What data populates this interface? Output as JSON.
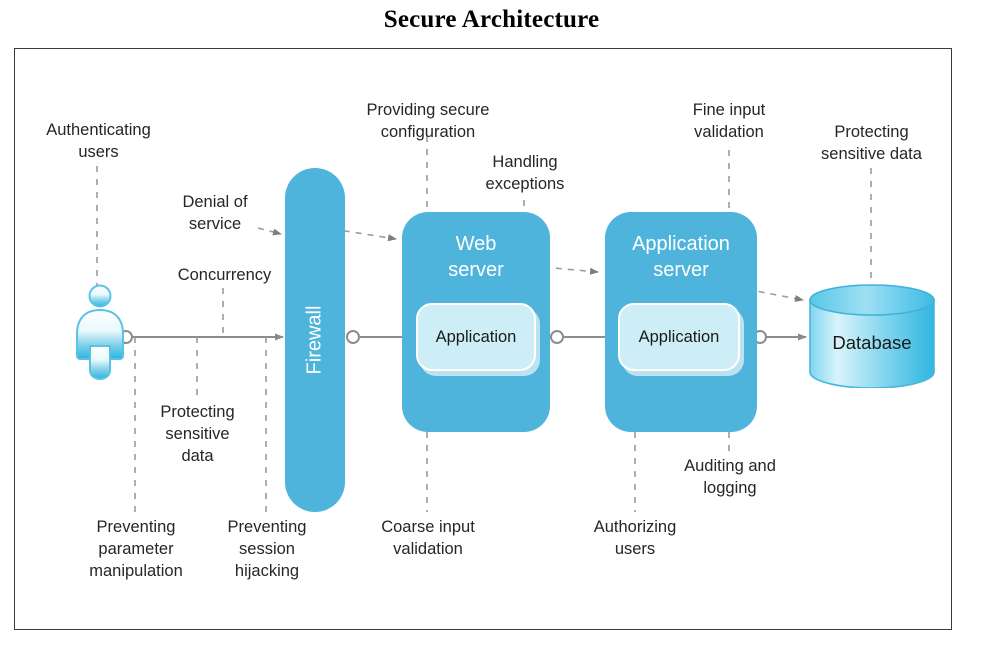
{
  "title": "Secure Architecture",
  "diagram": {
    "type": "architecture-flow",
    "accent_color": "#4fb4dc",
    "inner_color": "#cdeef6",
    "line_color": "#8c8c8c",
    "frame_color": "#3a3a3a",
    "text_color": "#262626"
  },
  "nodes": {
    "actor": {
      "name": "actor",
      "label": ""
    },
    "firewall": {
      "label": "Firewall"
    },
    "web_server": {
      "label": "Web\nserver",
      "inner_label": "Application"
    },
    "app_server": {
      "label": "Application\nserver",
      "inner_label": "Application"
    },
    "database": {
      "label": "Database"
    }
  },
  "annotations": {
    "authenticating_users": "Authenticating\nusers",
    "denial_of_service": "Denial of\nservice",
    "concurrency": "Concurrency",
    "protecting_sensitive_data_left": "Protecting\nsensitive\ndata",
    "preventing_parameter_manipulation": "Preventing\nparameter\nmanipulation",
    "preventing_session_hijacking": "Preventing\nsession\nhijacking",
    "providing_secure_configuration": "Providing secure\nconfiguration",
    "handling_exceptions": "Handling\nexceptions",
    "coarse_input_validation": "Coarse input\nvalidation",
    "fine_input_validation": "Fine input\nvalidation",
    "protecting_sensitive_data_right": "Protecting\nsensitive data",
    "authorizing_users": "Authorizing\nusers",
    "auditing_and_logging": "Auditing and\nlogging"
  }
}
